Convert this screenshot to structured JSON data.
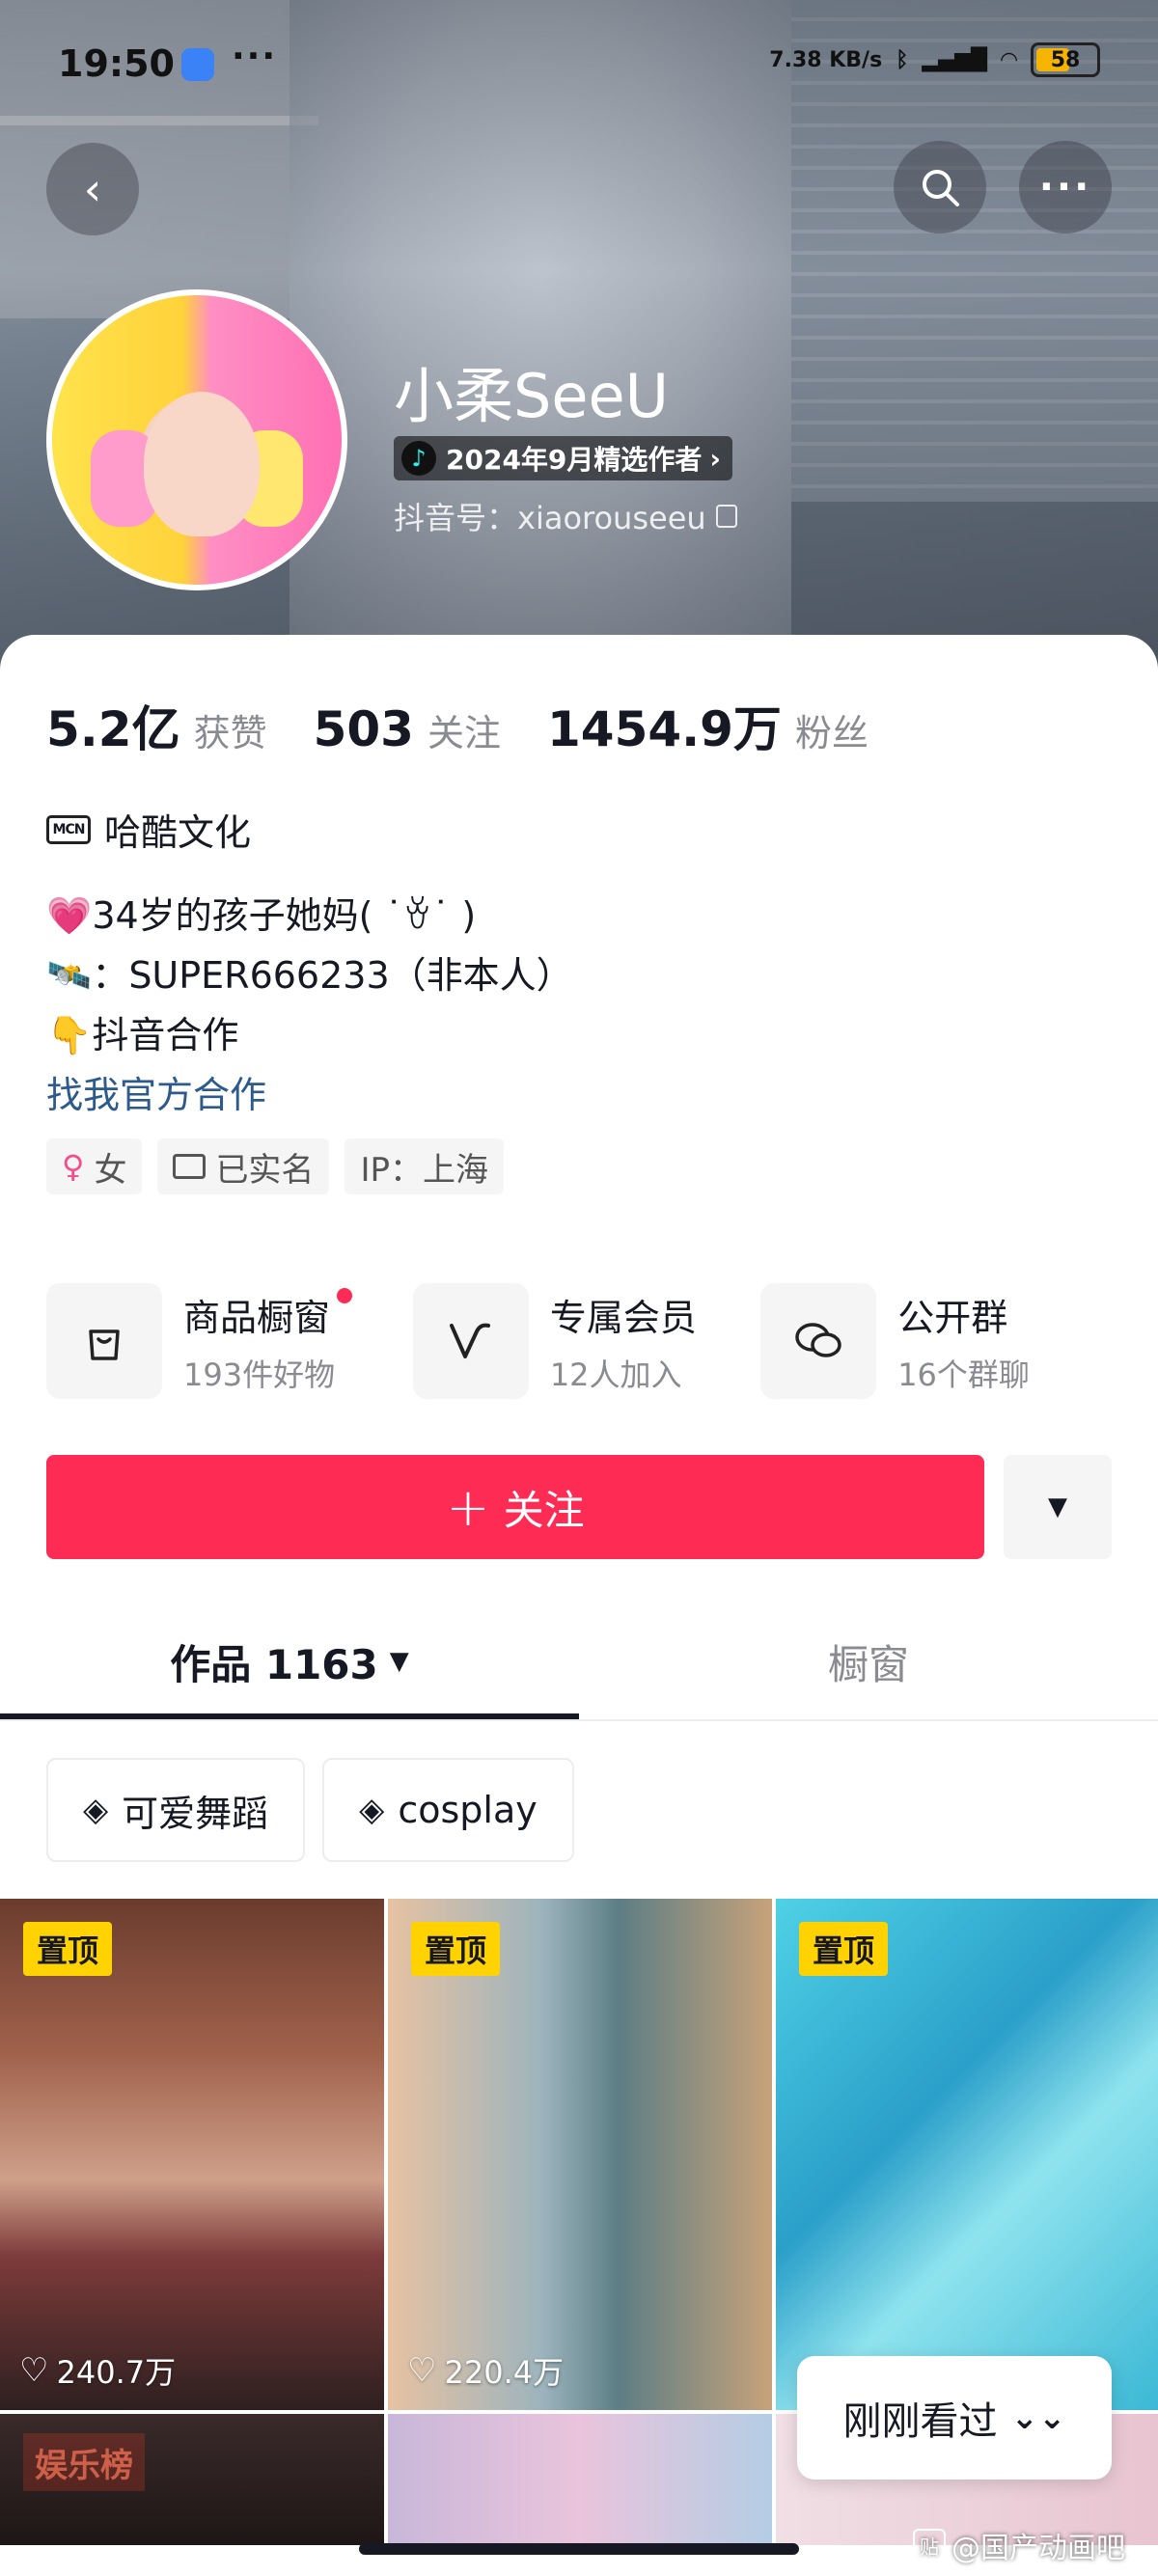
{
  "status_bar": {
    "time": "19:50",
    "more": "···",
    "net_speed": "7.38 KB/s",
    "battery": "58"
  },
  "profile": {
    "name": "小柔SeeU",
    "badge": "2024年9月精选作者",
    "douyin_id": "抖音号：xiaorouseeu"
  },
  "stats": [
    {
      "num": "5.2亿",
      "label": "获赞"
    },
    {
      "num": "503",
      "label": "关注"
    },
    {
      "num": "1454.9万",
      "label": "粉丝"
    }
  ],
  "mcn": {
    "icon_text": "MCN",
    "org": "哈酷文化"
  },
  "bio": {
    "line1": "💗34岁的孩子她妈( ˙ꈊ˙ )",
    "line2": "🛰️：SUPER666233（非本人）",
    "line3": "👇抖音合作",
    "link": "找我官方合作"
  },
  "tags": {
    "gender_icon": "♀",
    "gender": "女",
    "verified": "已实名",
    "ip": "IP：上海"
  },
  "services": [
    {
      "title": "商品橱窗",
      "sub": "193件好物",
      "icon": "bag-icon"
    },
    {
      "title": "专属会员",
      "sub": "12人加入",
      "icon": "v-icon"
    },
    {
      "title": "公开群",
      "sub": "16个群聊",
      "icon": "chat-icon"
    }
  ],
  "follow": {
    "plus": "+",
    "label": "关注"
  },
  "tabs": {
    "works": "作品 1163",
    "showcase": "橱窗"
  },
  "chips": [
    {
      "label": "可爱舞蹈"
    },
    {
      "label": "cosplay"
    }
  ],
  "videos": [
    {
      "pin": "置顶",
      "likes": "240.7万"
    },
    {
      "pin": "置顶",
      "likes": "220.4万"
    },
    {
      "pin": "置顶",
      "likes": ""
    },
    {
      "rank": "娱乐榜"
    }
  ],
  "just_watched": "刚刚看过",
  "watermark": {
    "icon": "贴",
    "text": "@国产动画吧"
  },
  "colors": {
    "accent": "#fe2c55",
    "link": "#2d5a8c",
    "pin": "#ffd200"
  }
}
